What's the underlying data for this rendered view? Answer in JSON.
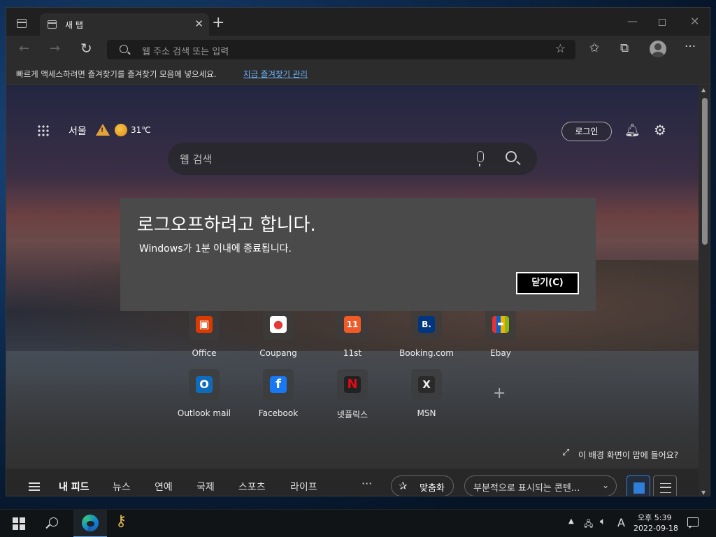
{
  "browser": {
    "tab_title": "새 탭",
    "tab_close": "✕",
    "new_tab": "+",
    "win_min": "—",
    "win_close": "✕",
    "nav_back": "←",
    "nav_forward": "→",
    "nav_refresh": "↻",
    "address_placeholder": "웹 주소 검색 또는 입력",
    "menu": "···",
    "favorites_bar_text": "빠르게 액세스하려면 즐겨찾기를 즐겨찾기 모음에 넣으세요.",
    "favorites_bar_link": "지금 즐겨찾기 관리"
  },
  "ntp": {
    "weather": {
      "city": "서울",
      "temperature": "31℃"
    },
    "login_label": "로그인",
    "search_placeholder": "웹 검색",
    "quick_links": [
      {
        "label": "Office",
        "glyph": "▣",
        "color": "#d83b01"
      },
      {
        "label": "Coupang",
        "glyph": "●",
        "color": "#e53935"
      },
      {
        "label": "11st",
        "glyph": "11",
        "color": "#f05a28"
      },
      {
        "label": "Booking.com",
        "glyph": "B.",
        "color": "#003580"
      },
      {
        "label": "Ebay",
        "glyph": "▬",
        "color": "#6a6a6a"
      },
      {
        "label": "Outlook mail",
        "glyph": "O",
        "color": "#0f6cbd"
      },
      {
        "label": "Facebook",
        "glyph": "f",
        "color": "#1877f2"
      },
      {
        "label": "넷플릭스",
        "glyph": "N",
        "color": "#b20710"
      },
      {
        "label": "MSN",
        "glyph": "Ⅹ",
        "color": "#2a2a2a"
      }
    ],
    "add_link": "+",
    "background_prompt": "이 배경 화면이 맘에 들어요?",
    "feed": {
      "tabs": [
        "내 피드",
        "뉴스",
        "연예",
        "국제",
        "스포츠",
        "라이프"
      ],
      "more": "···",
      "personalize": "맞춤화",
      "content_select": "부분적으로 표시되는 콘텐..."
    }
  },
  "dialog": {
    "title": "로그오프하려고 합니다.",
    "message": "Windows가 1분 이내에 종료됩니다.",
    "close_label": "닫기(C)"
  },
  "taskbar": {
    "ime": "A",
    "time": "오후 5:39",
    "date": "2022-09-18"
  },
  "colors": {
    "accent": "#2f7ed8",
    "link": "#6fb5ff",
    "dialog_bg": "#4a4a4a"
  }
}
